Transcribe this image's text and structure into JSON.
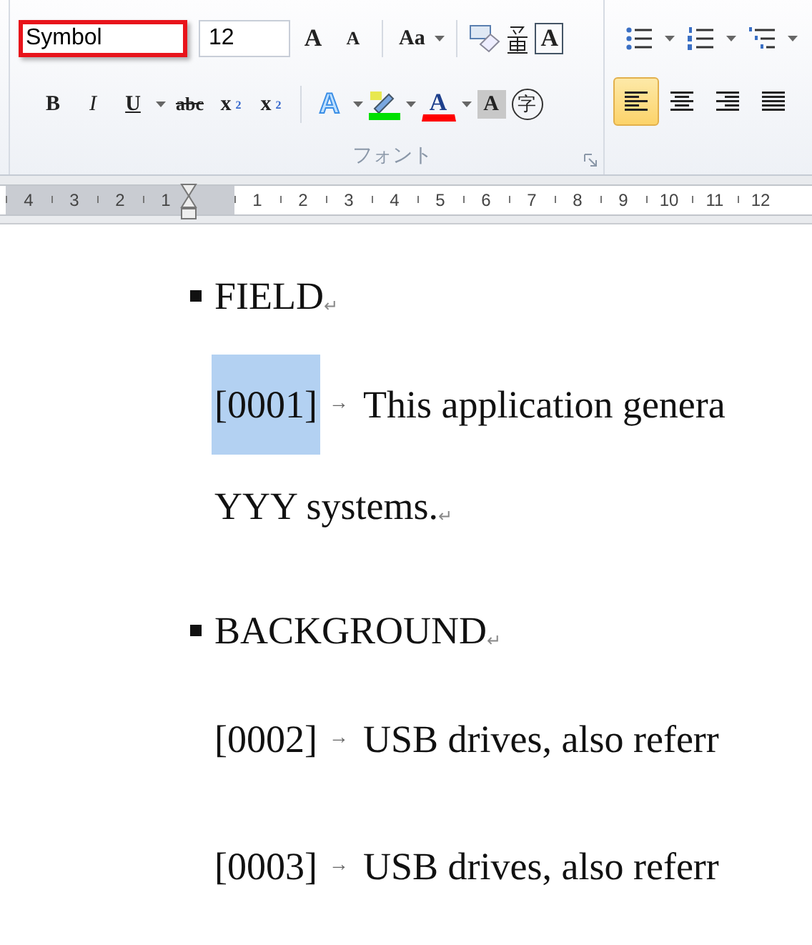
{
  "ribbon": {
    "font_group": {
      "font_name": {
        "value": "Symbol",
        "highlighted": true
      },
      "font_size": {
        "value": "12"
      },
      "row1": [
        {
          "kind": "grow",
          "label": "A"
        },
        {
          "kind": "shrink",
          "label": "A"
        },
        {
          "kind": "sep"
        },
        {
          "kind": "case",
          "label": "Aa",
          "dropdown": true
        },
        {
          "kind": "sep"
        },
        {
          "kind": "clear"
        },
        {
          "kind": "phonetic"
        },
        {
          "kind": "border",
          "label": "A"
        }
      ],
      "row2": [
        {
          "kind": "bold",
          "label": "B"
        },
        {
          "kind": "italic",
          "label": "I"
        },
        {
          "kind": "underline",
          "label": "U",
          "dropdown": true
        },
        {
          "kind": "strike",
          "label": "abc"
        },
        {
          "kind": "sub",
          "label": "x",
          "script": "2"
        },
        {
          "kind": "sup",
          "label": "x",
          "script": "2"
        },
        {
          "kind": "sep"
        },
        {
          "kind": "effect",
          "label": "A",
          "dropdown": true
        },
        {
          "kind": "highlight",
          "dropdown": true,
          "color": "#00e000"
        },
        {
          "kind": "fontcolor",
          "label": "A",
          "dropdown": true,
          "color": "#ff0000"
        },
        {
          "kind": "shade",
          "label": "A"
        },
        {
          "kind": "enclose",
          "label": "字"
        }
      ],
      "label": "フォント"
    },
    "paragraph_group": {
      "row1": [
        {
          "kind": "bullets",
          "dropdown": true
        },
        {
          "kind": "numbering",
          "dropdown": true
        },
        {
          "kind": "multilevel",
          "dropdown": true
        }
      ],
      "row2": [
        {
          "kind": "align-left",
          "selected": true
        },
        {
          "kind": "align-center",
          "selected": false
        },
        {
          "kind": "align-right",
          "selected": false
        },
        {
          "kind": "justify",
          "selected": false
        }
      ]
    }
  },
  "ruler": {
    "left_numbers": [
      "4",
      "3",
      "2",
      "1"
    ],
    "right_numbers": [
      "1",
      "2",
      "3",
      "4",
      "5",
      "6",
      "7",
      "8",
      "9",
      "10",
      "11",
      "12"
    ]
  },
  "document": {
    "paragraphs": [
      {
        "kind": "heading",
        "text": "FIELD",
        "end_mark": "↵"
      },
      {
        "kind": "numbered",
        "number": "[0001]",
        "number_selected": true,
        "tab_mark": "→",
        "text": "This application genera"
      },
      {
        "kind": "continuation",
        "text": "YYY systems.",
        "end_mark": "↵"
      },
      {
        "kind": "heading",
        "text": "BACKGROUND",
        "end_mark": "↵"
      },
      {
        "kind": "numbered",
        "number": "[0002]",
        "number_selected": false,
        "tab_mark": "→",
        "text": "USB drives, also referr"
      },
      {
        "kind": "numbered",
        "number": "[0003]",
        "number_selected": false,
        "tab_mark": "→",
        "text": "USB drives, also referr"
      }
    ]
  }
}
